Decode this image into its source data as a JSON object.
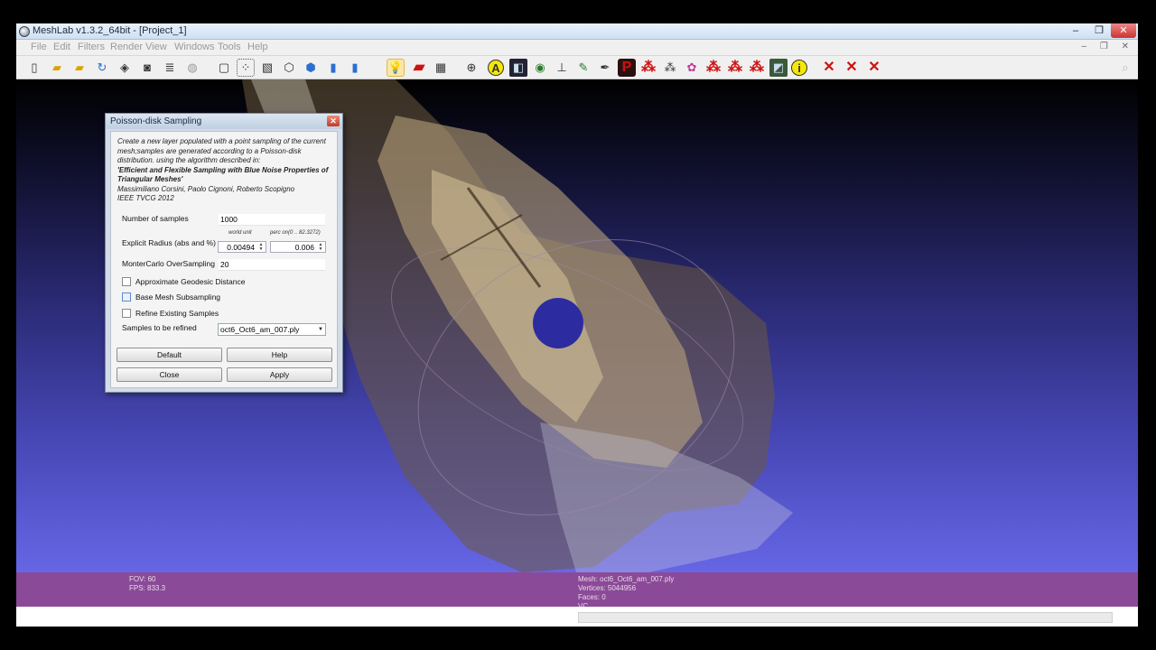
{
  "window": {
    "title": "MeshLab v1.3.2_64bit - [Project_1]",
    "min": "–",
    "max": "❒",
    "close": "✕"
  },
  "menu": {
    "items": [
      "File",
      "Edit",
      "Filters",
      "Render",
      "View",
      "Windows",
      "Tools",
      "Help"
    ],
    "mdi_controls": "– ❐ ✕"
  },
  "toolbar": {
    "icons": [
      "new-project",
      "open-project",
      "open-mesh",
      "reload",
      "export-mesh",
      "snapshot",
      "layers",
      "save",
      "bbox",
      "points",
      "wireframe",
      "hidden-lines",
      "flat-lines",
      "flat",
      "smooth",
      "lighting",
      "backface",
      "texture",
      "trackball",
      "annotation",
      "color",
      "select-vertex",
      "measure",
      "paint",
      "brush",
      "puppet",
      "align",
      "select-faces",
      "select-connected",
      "select-vertices",
      "z-paint",
      "move-selection",
      "fill-hole",
      "raster",
      "info",
      "delete-faces",
      "delete-vertices",
      "delete-all"
    ]
  },
  "dialog": {
    "title": "Poisson-disk Sampling",
    "close": "✕",
    "description": "Create a new layer populated with a point sampling of the current mesh;samples are generated according to a Poisson-disk distribution. using the algorithm described in:",
    "paper_title": "'Efficient and Flexible Sampling with Blue Noise Properties of Triangular Meshes'",
    "authors": "Massimiliano Corsini, Paolo Cignoni, Roberto Scopigno",
    "venue": "IEEE TVCG 2012",
    "num_samples_label": "Number of samples",
    "num_samples_value": "1000",
    "radius_label": "Explicit Radius (abs and %)",
    "radius_world_caption": "world unit",
    "radius_perc_caption": "perc on(0 .. 82.3272)",
    "radius_world_value": "0.00494",
    "radius_perc_value": "0.006",
    "montecarlo_label": "MonterCarlo OverSampling",
    "montecarlo_value": "20",
    "approx_geodesic_label": "Approximate Geodesic Distance",
    "base_mesh_label": "Base Mesh Subsampling",
    "refine_label": "Refine Existing Samples",
    "refine_samples_label": "Samples to be refined",
    "refine_samples_value": "oct6_Oct6_am_007.ply",
    "buttons": {
      "default": "Default",
      "help": "Help",
      "close": "Close",
      "apply": "Apply"
    }
  },
  "info": {
    "fov": "FOV: 60",
    "fps": "FPS:   833.3",
    "mesh": "Mesh: oct6_Oct6_am_007.ply",
    "vertices": "Vertices: 5044956",
    "faces": "Faces: 0",
    "vc": "VC"
  },
  "colors": {
    "viewport_top": "#000000",
    "viewport_bottom": "#6666e6",
    "infobar": "#8b4a97"
  }
}
